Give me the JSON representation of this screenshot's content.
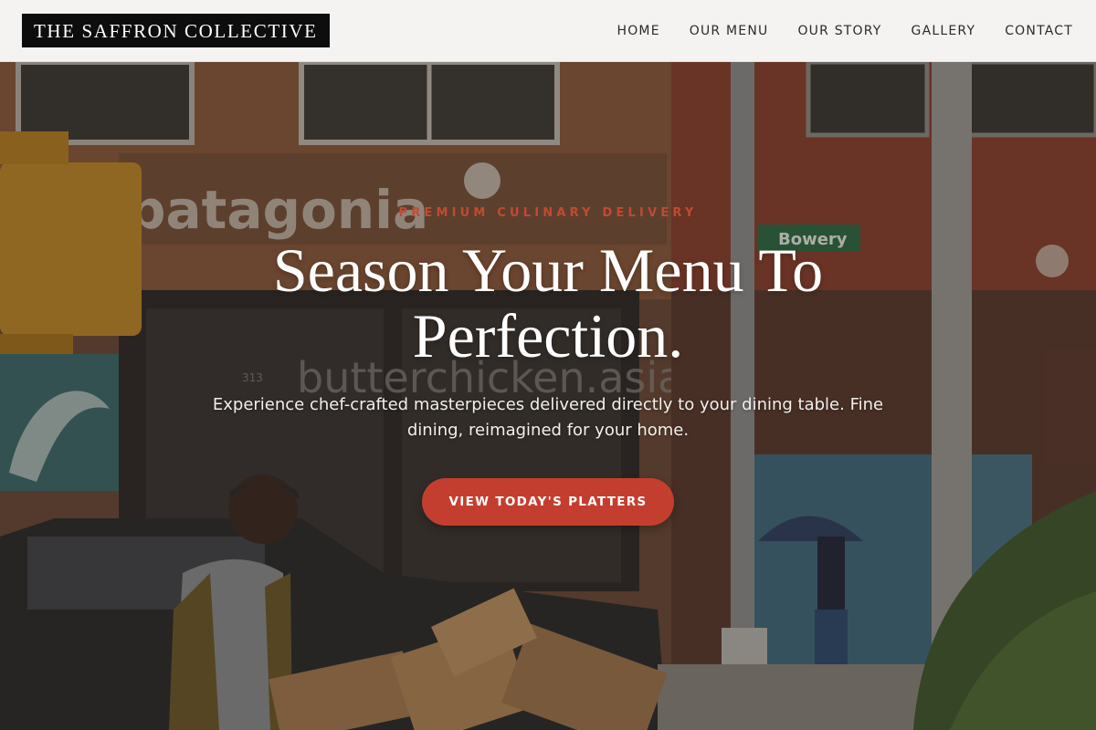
{
  "header": {
    "brand": "THE SAFFRON COLLECTIVE",
    "nav": [
      "HOME",
      "OUR MENU",
      "OUR STORY",
      "GALLERY",
      "CONTACT"
    ]
  },
  "hero": {
    "eyebrow": "PREMIUM CULINARY DELIVERY",
    "headline": "Season Your Menu To Perfection.",
    "subtext": "Experience chef-crafted masterpieces delivered directly to your dining table. Fine dining, reimagined for your home.",
    "cta_label": "VIEW TODAY'S PLATTERS",
    "background_signs": {
      "storefront": "patagonia",
      "street_sign": "Bowery",
      "window_text": "butterchicken.asia",
      "door_number": "313"
    }
  },
  "colors": {
    "accent": "#c43e2f",
    "eyebrow": "#c24a32",
    "header_bg": "#f4f3f2",
    "logo_bg": "#0d0d0d"
  }
}
